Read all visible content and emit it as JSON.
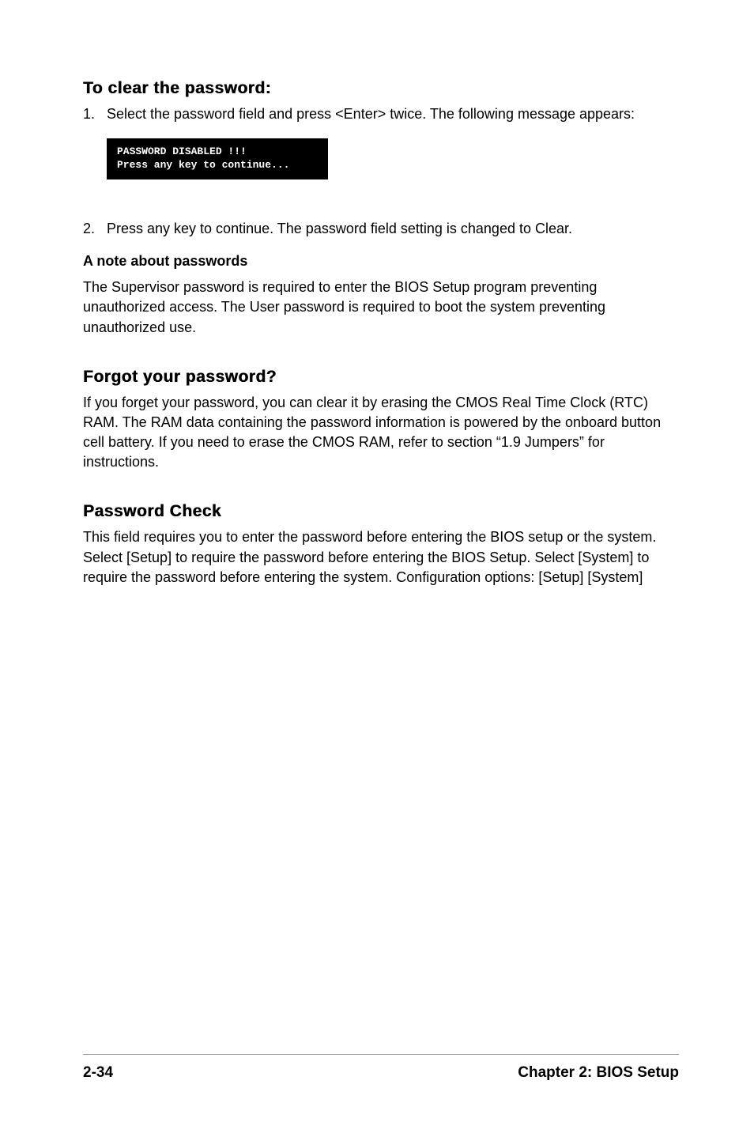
{
  "sections": {
    "clear_password": {
      "heading": "To clear the password:",
      "step1_num": "1.",
      "step1_text": "Select the password field and press <Enter> twice. The following message appears:",
      "code_line1": "PASSWORD DISABLED !!!",
      "code_line2": "Press any key to continue...",
      "step2_num": "2.",
      "step2_text": "Press any key to continue. The password field setting is changed to Clear.",
      "note_heading": "A note about passwords",
      "note_text": "The Supervisor password is required to enter the BIOS Setup program preventing unauthorized access. The User password is required to boot the system preventing unauthorized use."
    },
    "forgot_password": {
      "heading": "Forgot your password?",
      "text": "If you forget your password, you can clear it by erasing the CMOS Real Time Clock (RTC) RAM. The RAM data containing the password information is powered by the onboard button cell battery. If you need to erase the CMOS RAM, refer to section “1.9 Jumpers” for instructions."
    },
    "password_check": {
      "heading": "Password Check",
      "text": "This field requires you to enter the password before entering the BIOS setup or the system. Select [Setup] to require the password before entering the BIOS Setup. Select [System] to require the password before entering the system. Configuration options: [Setup] [System]"
    }
  },
  "footer": {
    "page": "2-34",
    "chapter": "Chapter 2: BIOS Setup"
  }
}
